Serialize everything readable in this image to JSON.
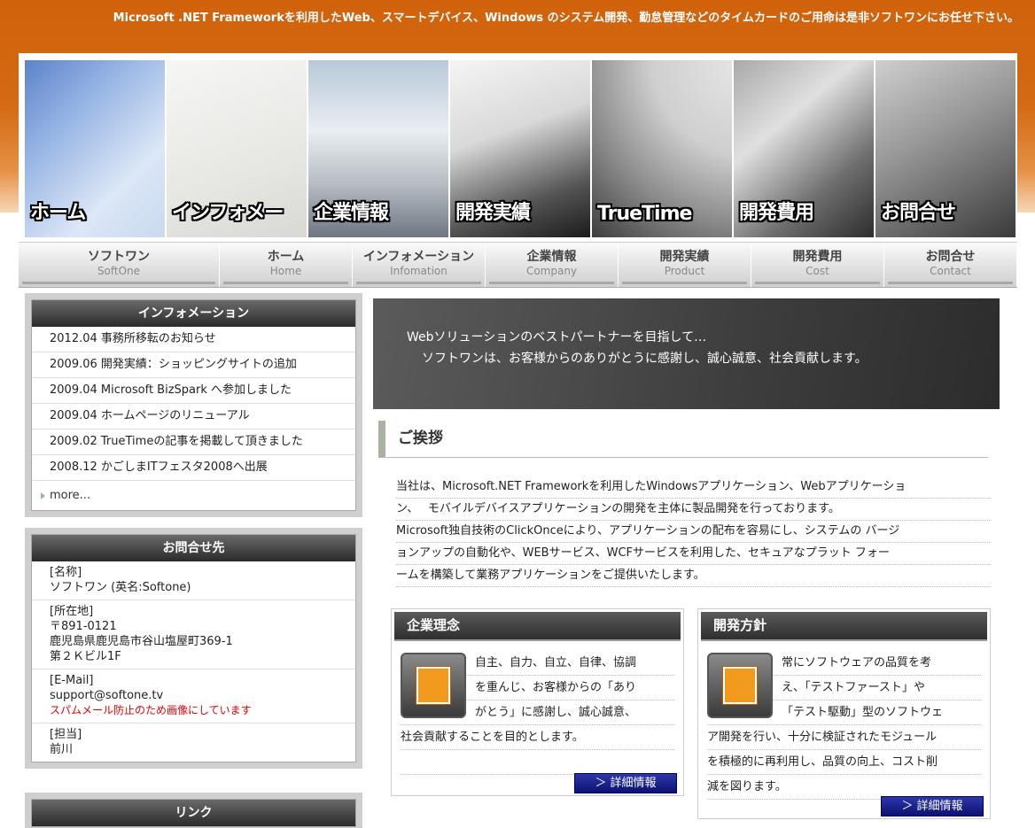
{
  "header": {
    "tagline": "Microsoft .NET Frameworkを利用したWeb、スマートデバイス、Windows のシステム開発、勤怠管理などのタイムカードのご用命は是非ソフトワンにお任せ下さい。"
  },
  "banner": {
    "panels": [
      {
        "label": "ホーム"
      },
      {
        "label": "インフォメー"
      },
      {
        "label": "企業情報"
      },
      {
        "label": "開発実績"
      },
      {
        "label": "TrueTime"
      },
      {
        "label": "開発費用"
      },
      {
        "label": "お問合せ"
      }
    ]
  },
  "nav": {
    "items": [
      {
        "jp": "ソフトワン",
        "en": "SoftOne"
      },
      {
        "jp": "ホーム",
        "en": "Home"
      },
      {
        "jp": "インフォメーション",
        "en": "Infomation"
      },
      {
        "jp": "企業情報",
        "en": "Company"
      },
      {
        "jp": "開発実績",
        "en": "Product"
      },
      {
        "jp": "開発費用",
        "en": "Cost"
      },
      {
        "jp": "お問合せ",
        "en": "Contact"
      }
    ]
  },
  "sidebar": {
    "info": {
      "title": "インフォメーション",
      "items": [
        "2012.04  事務所移転のお知らせ",
        "2009.06  開発実績：ショッピングサイトの追加",
        "2009.04  Microsoft BizSpark へ参加しました",
        "2009.04  ホームページのリニューアル",
        "2009.02  TrueTimeの記事を掲載して頂きました",
        "2008.12  かごしまITフェスタ2008へ出展"
      ],
      "more": "more..."
    },
    "contact": {
      "title": "お問合せ先",
      "name_label": "[名称]",
      "name_value": "ソフトワン (英名:Softone)",
      "address_label": "[所在地]",
      "address_zip": "〒891-0121",
      "address_line1": "鹿児島県鹿児島市谷山塩屋町369-1",
      "address_line2": "第２Ｋビル1F",
      "email_label": "[E-Mail]",
      "email_value": "support@softone.tv",
      "email_note": "スパムメール防止のため画像にしています",
      "person_label": "[担当]",
      "person_value": "前川"
    },
    "links": {
      "title": "リンク"
    }
  },
  "main": {
    "hero": {
      "line1": "Webソリューションのベストパートナーを目指して…",
      "line2": "ソフトワンは、お客様からのありがとうに感謝し、誠心誠意、社会貢献します。"
    },
    "greeting": {
      "title": "ご挨拶",
      "lines": [
        "当社は、Microsoft.NET Frameworkを利用したWindowsアプリケーション、Webアプリケーショ",
        "ン、　 モバイルデバイスアプリケーションの開発を主体に製品開発を行っております。",
        "Microsoft独自技術のClickOnceにより、アプリケーションの配布を容易にし、システムの バージ",
        "ョンアップの自動化や、WEBサービス、WCFサービスを利用した、セキュアなプラット フォー",
        "ームを構築して業務アプリケーションをご提供いたします。"
      ]
    },
    "cards": [
      {
        "title": "企業理念",
        "lines": [
          "自主、自力、自立、自律、協調",
          "を重んじ、お客様からの「あり",
          "がとう」に感謝し、誠心誠意、",
          "社会貢献することを目的とします。"
        ],
        "button": "＞ 詳細情報"
      },
      {
        "title": "開発方針",
        "lines": [
          "常にソフトウェアの品質を考",
          "え、「テストファースト」や",
          "「テスト駆動」型のソフトウェ",
          "ア開発を行い、十分に検証されたモジュール",
          "を積極的に再利用し、品質の向上、コスト削",
          "減を図ります。"
        ],
        "button": "＞ 詳細情報"
      }
    ]
  },
  "colors": {
    "header_orange": "#d46a14",
    "dark_bar": "#2f2f2f",
    "button_blue": "#1a2290",
    "alert_red": "#e00000"
  }
}
